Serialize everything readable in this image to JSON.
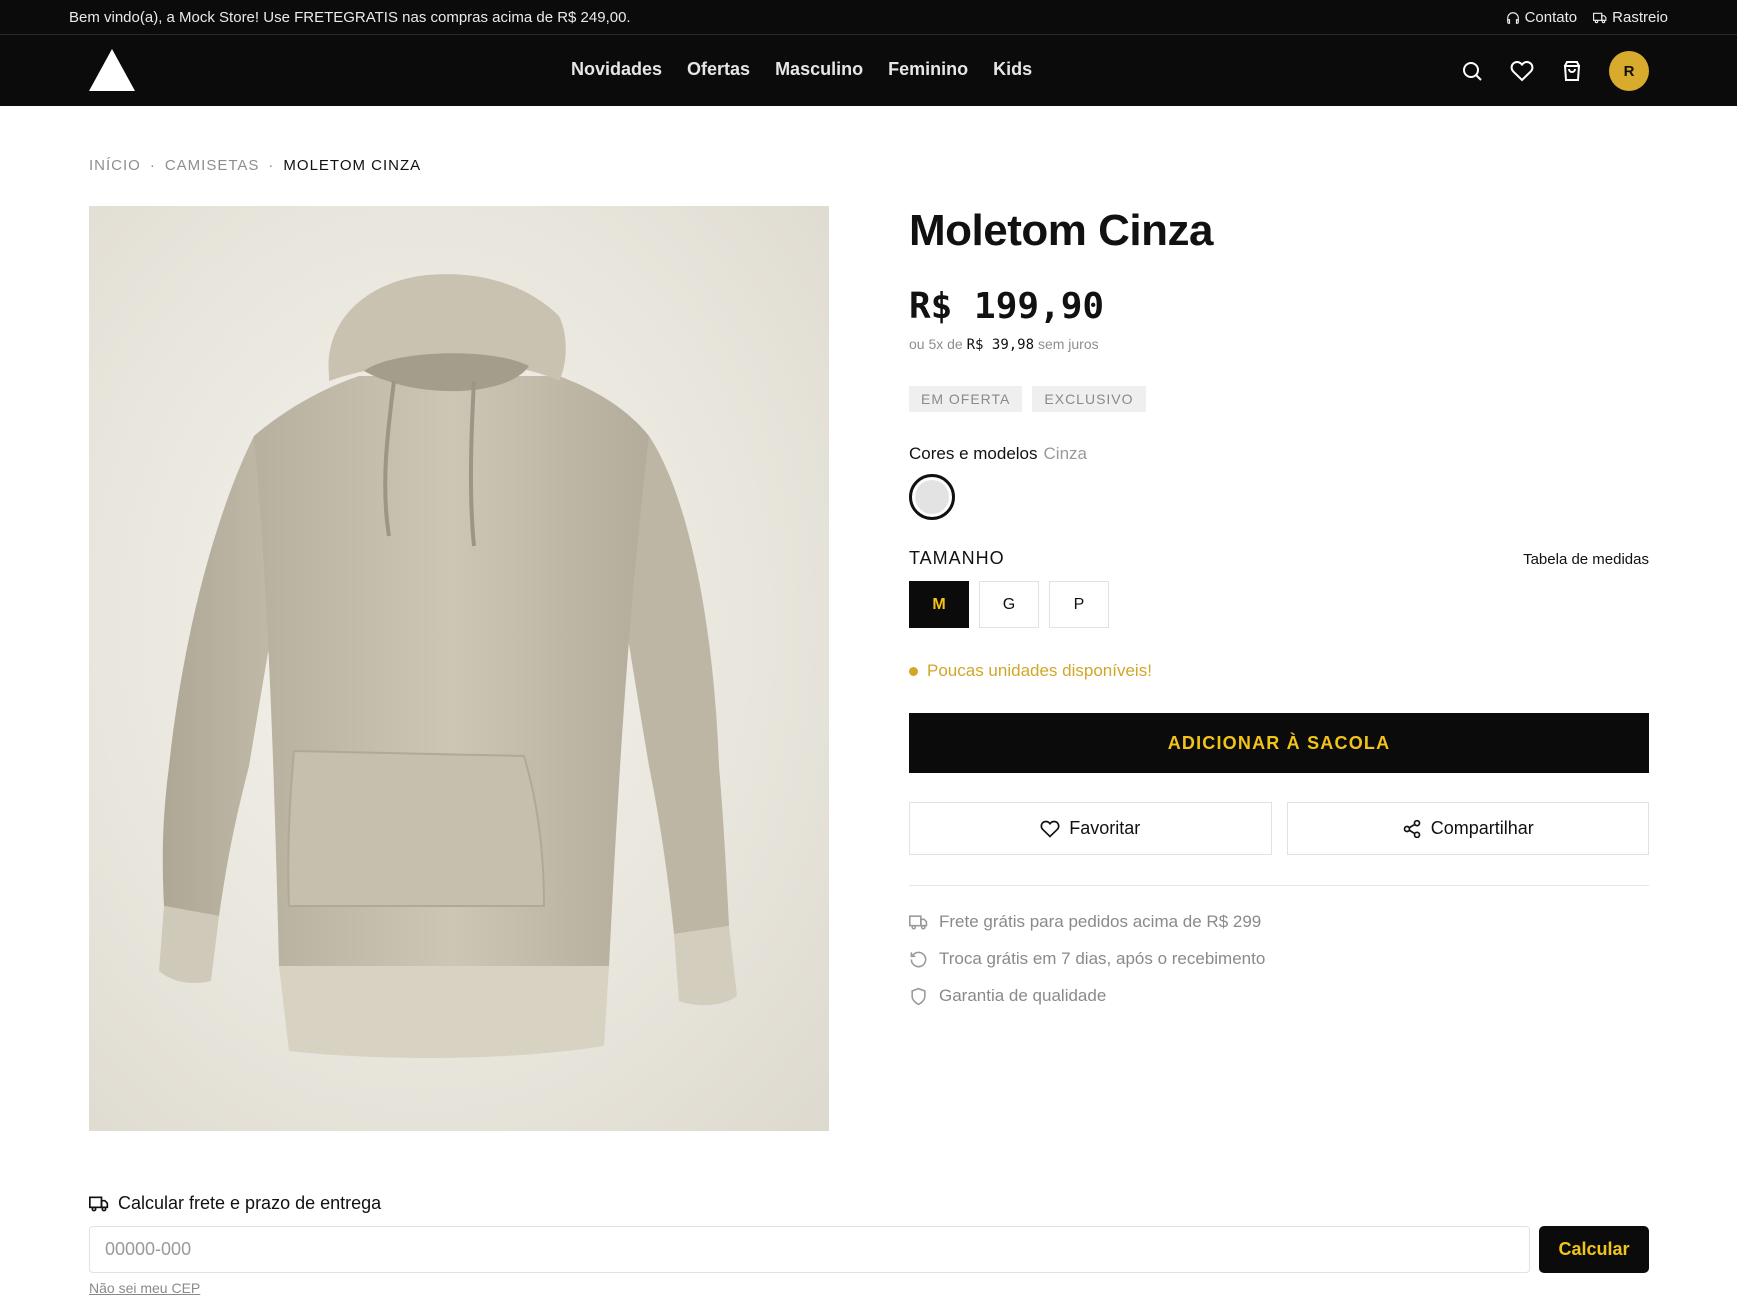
{
  "topbar": {
    "message": "Bem vindo(a), a Mock Store! Use FRETEGRATIS nas compras acima de R$ 249,00.",
    "contact": "Contato",
    "tracking": "Rastreio"
  },
  "header": {
    "nav": [
      "Novidades",
      "Ofertas",
      "Masculino",
      "Feminino",
      "Kids"
    ],
    "avatar_initial": "R",
    "icons": [
      "search-icon",
      "heart-icon",
      "bag-icon"
    ]
  },
  "breadcrumb": [
    "INÍCIO",
    "CAMISETAS",
    "MOLETOM CINZA"
  ],
  "product": {
    "title": "Moletom Cinza",
    "price": "R$ 199,90",
    "installments_prefix": "ou 5x de",
    "installments_value": "R$ 39,98",
    "installments_suffix": "sem juros",
    "badges": [
      "EM OFERTA",
      "EXCLUSIVO"
    ],
    "colors_label": "Cores e modelos",
    "selected_color": "Cinza",
    "swatch_color": "#e3e3e3",
    "size_label": "TAMANHO",
    "size_table": "Tabela de medidas",
    "sizes": [
      "M",
      "G",
      "P"
    ],
    "selected_size": "M",
    "stock_message": "Poucas unidades disponíveis!",
    "add_to_bag": "ADICIONAR À SACOLA",
    "favorite": "Favoritar",
    "share": "Compartilhar",
    "perks": [
      "Frete grátis para pedidos acima de R$ 299",
      "Troca grátis em 7 dias, após o recebimento",
      "Garantia de qualidade"
    ]
  },
  "shipping": {
    "title": "Calcular frete e prazo de entrega",
    "placeholder": "00000-000",
    "button": "Calcular",
    "no_cep": "Não sei meu CEP"
  },
  "colors": {
    "accent": "#f2c318",
    "avatar": "#d9ab2c",
    "stock_warning": "#d2a629",
    "dark": "#0b0b0b"
  }
}
